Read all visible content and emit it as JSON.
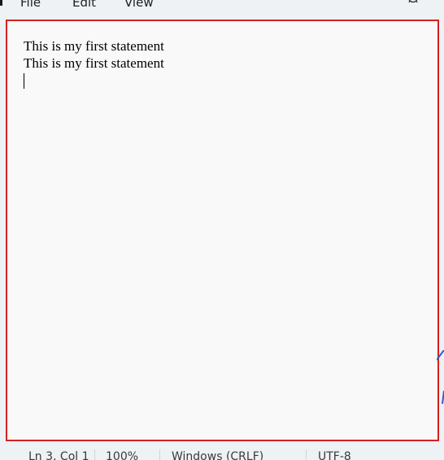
{
  "menu": {
    "file_label": "File",
    "edit_label": "Edit",
    "view_label": "View"
  },
  "toolbar": {
    "settings_icon": "gear-icon"
  },
  "editor": {
    "lines": [
      "This is my first statement",
      "This is my first statement"
    ]
  },
  "statusbar": {
    "position": "Ln 3, Col 1",
    "zoom": "100%",
    "line_endings": "Windows (CRLF)",
    "encoding": "UTF-8"
  },
  "colors": {
    "highlight_border": "#d42020",
    "editor_bg": "#f9f9f9",
    "chrome_bg": "#eef2f5"
  }
}
